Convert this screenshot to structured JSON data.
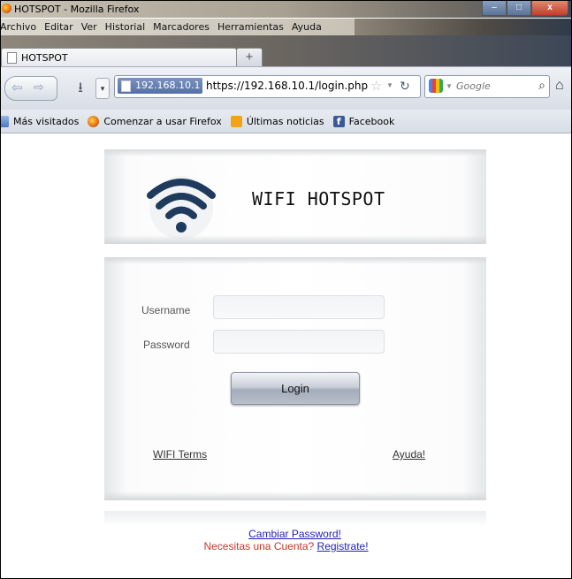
{
  "window": {
    "title": "HOTSPOT - Mozilla Firefox",
    "controls": {
      "minimize": "–",
      "maximize": "□",
      "close": "x"
    }
  },
  "menu": [
    "Archivo",
    "Editar",
    "Ver",
    "Historial",
    "Marcadores",
    "Herramientas",
    "Ayuda"
  ],
  "tabs": [
    {
      "label": "HOTSPOT"
    }
  ],
  "new_tab_label": "+",
  "navbar": {
    "site_badge": "192.168.10.1",
    "url": "https://192.168.10.1/login.php",
    "search_placeholder": "Google"
  },
  "bookmarks": [
    "Más visitados",
    "Comenzar a usar Firefox",
    "Últimas noticias",
    "Facebook"
  ],
  "page": {
    "brand": "WIFI HOTSPOT",
    "form": {
      "username_label": "Username",
      "username_value": "",
      "password_label": "Password",
      "password_value": "",
      "login_button": "Login"
    },
    "links": {
      "terms": "WIFI Terms",
      "help": "Ayuda!",
      "change_password": "Cambiar Password!",
      "need_account": "Necesitas una Cuenta?",
      "register": "Registrate!"
    }
  },
  "colors": {
    "wifi_logo": "#1e3a5c",
    "link_blue": "#1f1fb8",
    "link_red": "#c0392b"
  }
}
